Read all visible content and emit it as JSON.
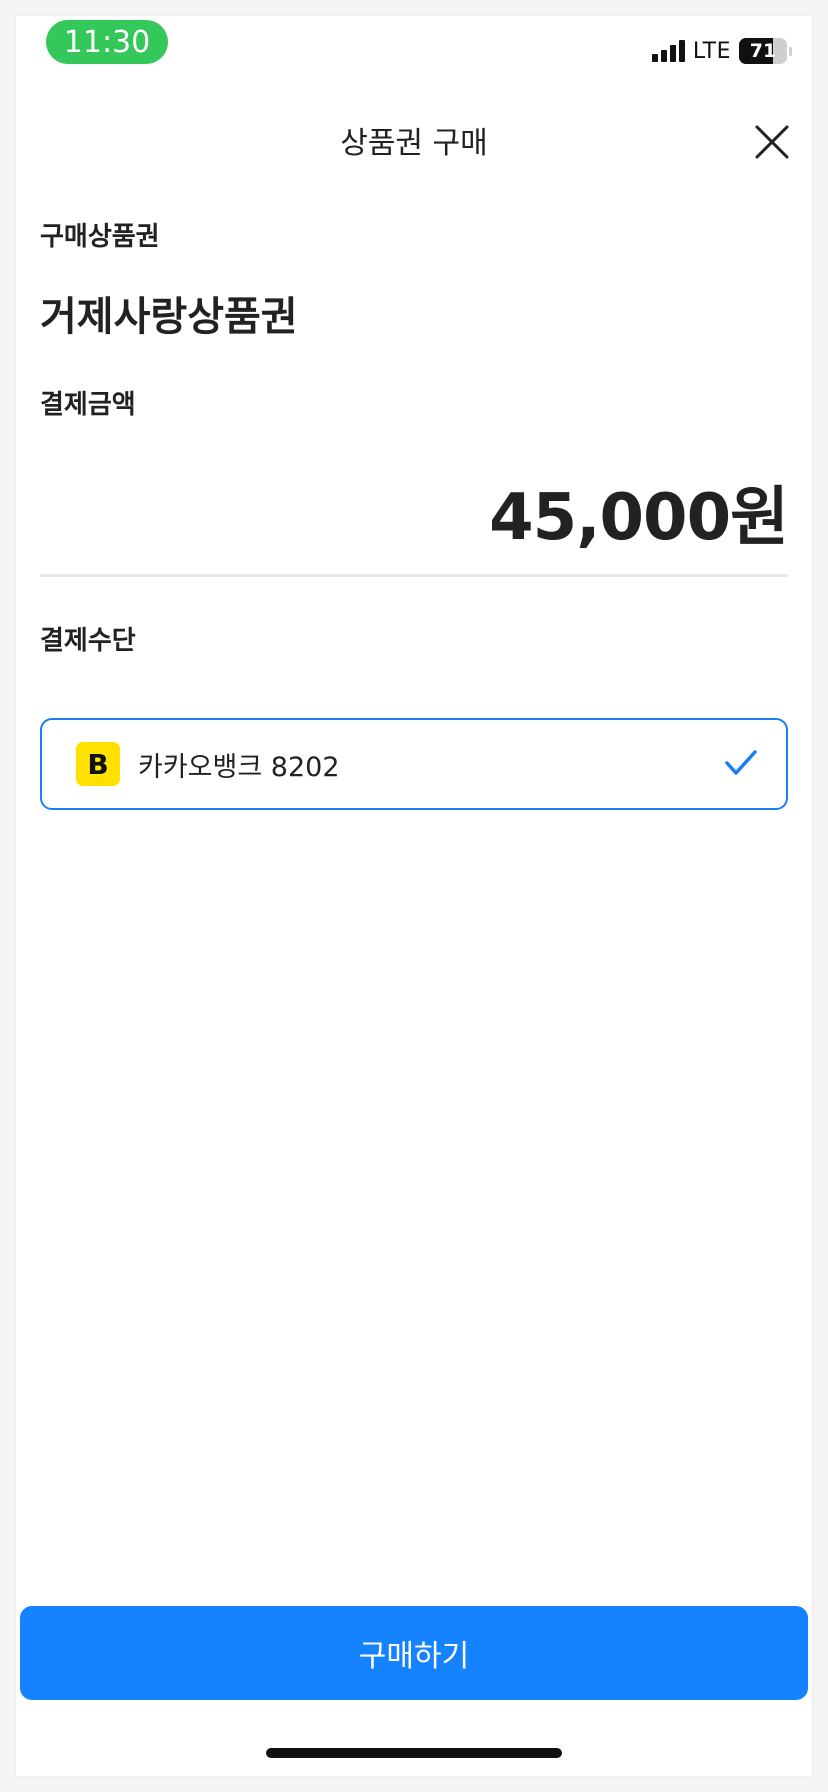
{
  "status_bar": {
    "time": "11:30",
    "network": "LTE",
    "battery": "71",
    "battery_level": 0.71
  },
  "header": {
    "title": "상품권 구매",
    "close_icon": "close-icon"
  },
  "purchase": {
    "product_label": "구매상품권",
    "product_name": "거제사랑상품권",
    "amount_label": "결제금액",
    "amount": "45,000원"
  },
  "payment": {
    "label": "결제수단",
    "method_name": "카카오뱅크 8202",
    "method_logo_letter": "B",
    "method_logo_icon": "kakaobank-logo-icon",
    "selected_icon": "check-icon",
    "selected": true
  },
  "footer": {
    "buy_label": "구매하기"
  },
  "colors": {
    "accent": "#1582ff",
    "selected_border": "#1a7ff0",
    "time_pill": "#34c759",
    "bank_logo": "#ffe100"
  }
}
